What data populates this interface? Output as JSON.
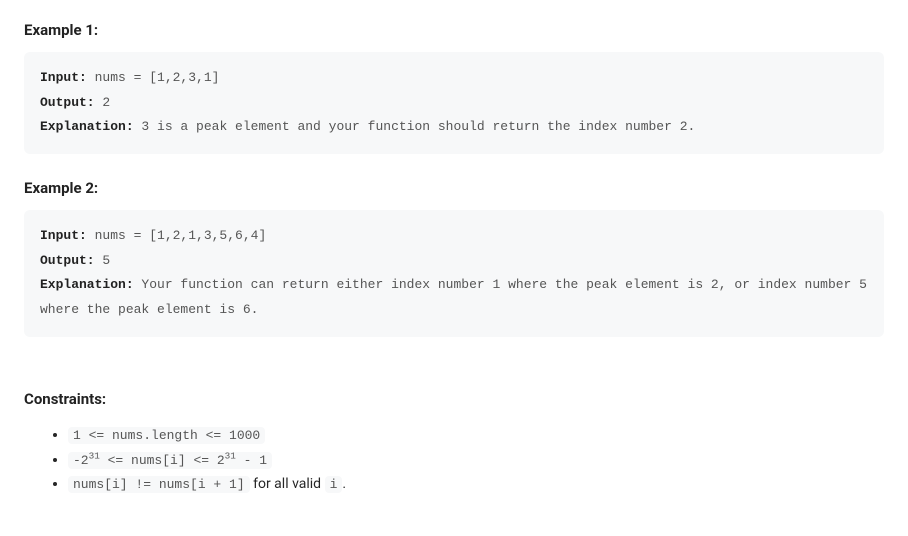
{
  "example1": {
    "heading": "Example 1:",
    "input_label": "Input:",
    "input_value": " nums = [1,2,3,1]",
    "output_label": "Output:",
    "output_value": " 2",
    "explanation_label": "Explanation:",
    "explanation_value": " 3 is a peak element and your function should return the index number 2."
  },
  "example2": {
    "heading": "Example 2:",
    "input_label": "Input:",
    "input_value": " nums = [1,2,1,3,5,6,4]",
    "output_label": "Output:",
    "output_value": " 5",
    "explanation_label": "Explanation:",
    "explanation_value": " Your function can return either index number 1 where the peak element is 2, or index number 5 where the peak element is 6."
  },
  "constraints": {
    "heading": "Constraints:",
    "item1": "1 <= nums.length <= 1000",
    "item2_pre": "-2",
    "item2_sup1": "31",
    "item2_mid": " <= nums[i] <= 2",
    "item2_sup2": "31",
    "item2_post": " - 1",
    "item3_code": "nums[i] != nums[i + 1]",
    "item3_text": " for all valid ",
    "item3_code2": "i",
    "item3_end": "."
  }
}
